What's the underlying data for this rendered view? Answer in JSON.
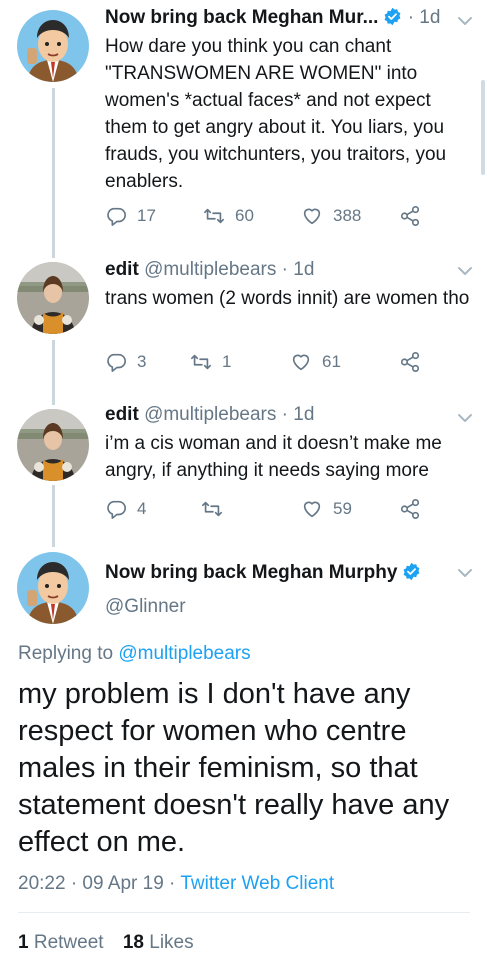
{
  "tweets": [
    {
      "name": "Now bring back Meghan Mur...",
      "handle": "",
      "time": "· 1d",
      "text": "How dare you think you can chant \"TRANSWOMEN ARE WOMEN\" into women's *actual faces* and not expect them to get angry about it. You liars, you frauds, you witchunters, you traitors, you enablers.",
      "replies": "17",
      "retweets": "60",
      "likes": "388"
    },
    {
      "name": "edit",
      "handle": "@multiplebears",
      "time": "· 1d",
      "text": "trans women (2 words innit) are women tho",
      "replies": "3",
      "retweets": "1",
      "likes": "61"
    },
    {
      "name": "edit",
      "handle": "@multiplebears",
      "time": "· 1d",
      "text": "i’m a cis woman and it doesn’t make me angry, if anything it needs saying more",
      "replies": "4",
      "retweets": "",
      "likes": "59"
    }
  ],
  "main_tweet": {
    "name": "Now bring back Meghan Murphy",
    "handle": "@Glinner",
    "replying_prefix": "Replying to",
    "replying_to": "@multiplebears",
    "text": "my problem is I don't have any respect for women who centre males in their feminism, so that statement doesn't really have any effect on me.",
    "timestamp": "20:22 · 09 Apr 19 · ",
    "client": "Twitter Web Client",
    "retweet_count": "1",
    "retweet_label": "Retweet",
    "like_count": "18",
    "like_label": "Likes"
  },
  "colors": {
    "accent": "#1da1f2",
    "muted": "#657786",
    "text": "#14171a",
    "divider": "#e6ecf0"
  }
}
